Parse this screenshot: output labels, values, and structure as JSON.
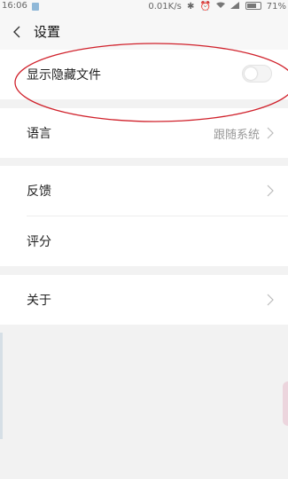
{
  "status_bar": {
    "time": "16:06",
    "speed": "0.01K/s",
    "bluetooth_icon": "✱",
    "alarm_icon": "⏰",
    "wifi_icon": "wifi",
    "signal_icon": "signal",
    "battery": "71%"
  },
  "nav": {
    "title": "设置"
  },
  "settings": {
    "show_hidden": {
      "label": "显示隐藏文件",
      "enabled": false
    },
    "language": {
      "label": "语言",
      "value": "跟随系统"
    },
    "feedback": {
      "label": "反馈"
    },
    "rate": {
      "label": "评分"
    },
    "about": {
      "label": "关于"
    }
  },
  "colors": {
    "annotation": "#d0212b",
    "background": "#f2f2f2"
  }
}
